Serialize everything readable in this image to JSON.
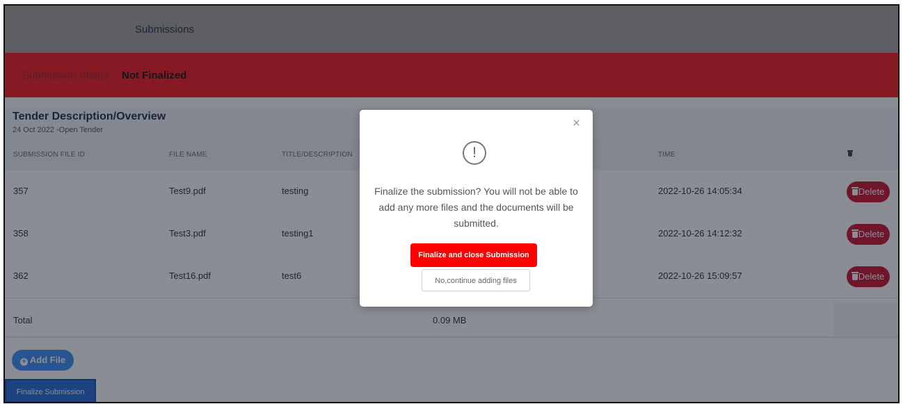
{
  "header": {
    "title": "Submissions"
  },
  "status": {
    "label": "Submission Status",
    "value": "Not Finalized"
  },
  "tender": {
    "title": "Tender Description/Overview",
    "subtitle": "24 Oct 2022 -Open Tender"
  },
  "table": {
    "columns": [
      "SUBMISSION FILE ID",
      "FILE NAME",
      "TITLE/DESCRIPTION",
      "TIME"
    ],
    "rows": [
      {
        "id": "357",
        "file": "Test9.pdf",
        "title": "testing",
        "time": "2022-10-26 14:05:34",
        "action": "Delete"
      },
      {
        "id": "358",
        "file": "Test3.pdf",
        "title": "testing1",
        "time": "2022-10-26 14:12:32",
        "action": "Delete"
      },
      {
        "id": "362",
        "file": "Test16.pdf",
        "title": "test6",
        "time": "2022-10-26 15:09:57",
        "action": "Delete"
      }
    ],
    "total_label": "Total",
    "total_size": "0.09 MB"
  },
  "actions": {
    "add_file": "Add File",
    "finalize": "Finalize Submission"
  },
  "modal": {
    "close": "×",
    "icon": "!",
    "message": "Finalize the submission? You will not be able to add any more files and the documents will be submitted.",
    "confirm": "Finalize and close Submission",
    "cancel": "No,continue adding files"
  },
  "icons": {
    "alert": "exclamation-circle-icon",
    "trash": "trash-icon",
    "add": "plus-circle-icon",
    "close": "close-icon"
  },
  "colors": {
    "status_bar": "#f51620",
    "delete": "#c8102e",
    "confirm": "#ff0000",
    "add": "#3b8ff7",
    "finalize": "#1f6ad6"
  }
}
